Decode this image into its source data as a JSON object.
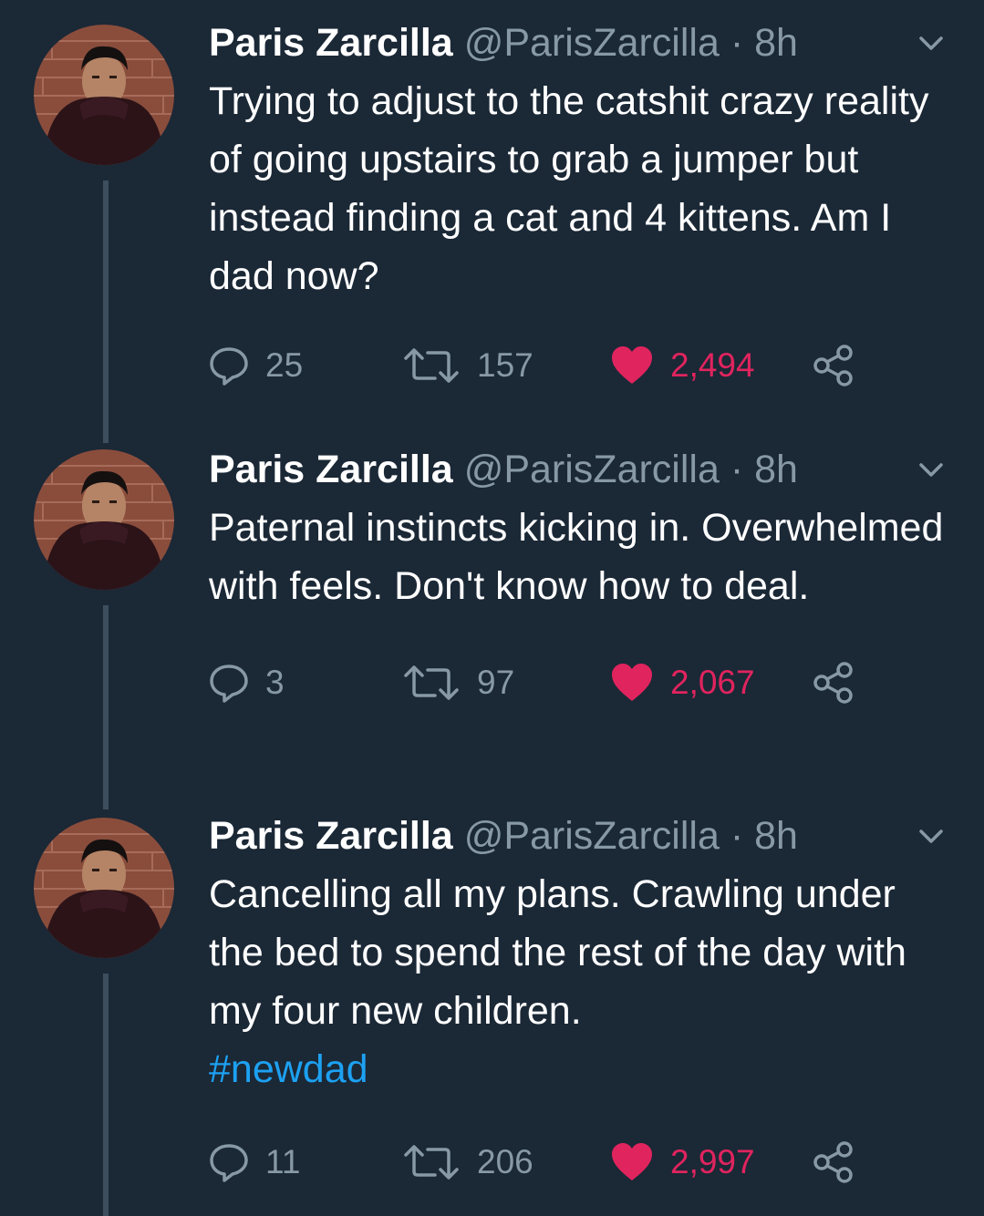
{
  "tweets": [
    {
      "name": "Paris Zarcilla",
      "handle": "@ParisZarcilla",
      "separator": " · ",
      "time": "8h",
      "text": "Trying to adjust to the catshit crazy reality of going upstairs to grab a jumper but instead finding a cat and 4 kittens. Am I dad now?",
      "hashtag": "",
      "replies": "25",
      "retweets": "157",
      "likes": "2,494"
    },
    {
      "name": "Paris Zarcilla",
      "handle": "@ParisZarcilla",
      "separator": " · ",
      "time": "8h",
      "text": "Paternal instincts kicking in. Overwhelmed with feels. Don't know how to deal.",
      "hashtag": "",
      "replies": "3",
      "retweets": "97",
      "likes": "2,067"
    },
    {
      "name": "Paris Zarcilla",
      "handle": "@ParisZarcilla",
      "separator": " · ",
      "time": "8h",
      "text": "Cancelling all my plans. Crawling under the bed to spend the rest of the day with my four new children.",
      "hashtag": "#newdad",
      "replies": "11",
      "retweets": "206",
      "likes": "2,997"
    }
  ],
  "colors": {
    "background": "#1b2836",
    "text": "#ffffff",
    "secondary": "#8899a6",
    "like": "#e0245e",
    "hashtag": "#1da1f2",
    "thread_line": "#3d4e5e"
  },
  "icons": {
    "reply": "speech-bubble-icon",
    "retweet": "retweet-arrows-icon",
    "like": "heart-icon",
    "share": "share-nodes-icon",
    "caret": "chevron-down-icon"
  }
}
